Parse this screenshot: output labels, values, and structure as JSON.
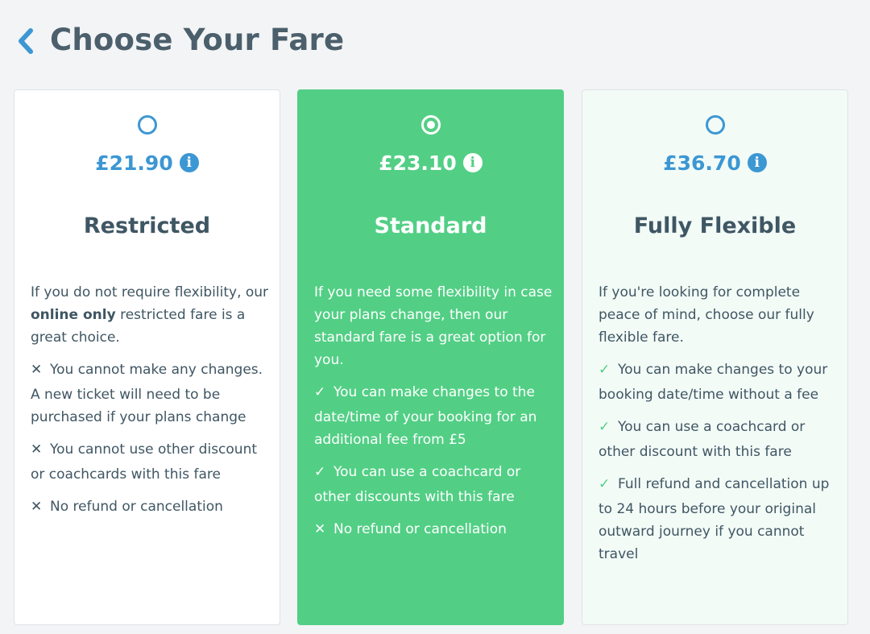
{
  "header": {
    "title": "Choose Your Fare",
    "back_icon": "chevron-left-icon",
    "accent_color": "#3c97d3"
  },
  "fares": [
    {
      "selected": false,
      "price": "£21.90",
      "name": "Restricted",
      "desc_pre": "If you do not require flexibility, our ",
      "desc_bold": "online only",
      "desc_post": " restricted fare is a great choice.",
      "features": [
        {
          "mark": "✕",
          "type": "cross",
          "first": "You cannot make any changes.",
          "rest": "A new ticket will need to be purchased if your plans change"
        },
        {
          "mark": "✕",
          "type": "cross",
          "first": "You cannot use other discount",
          "rest": "or coachcards with this fare"
        },
        {
          "mark": "✕",
          "type": "cross",
          "first": "No refund or cancellation",
          "rest": ""
        }
      ]
    },
    {
      "selected": true,
      "price": "£23.10",
      "name": "Standard",
      "desc_pre": "If you need some flexibility in case your plans change, then our standard fare is a great option for you.",
      "desc_bold": "",
      "desc_post": "",
      "features": [
        {
          "mark": "✓",
          "type": "tick",
          "first": "You can make changes to the",
          "rest": "date/time of your booking for an additional fee from £5"
        },
        {
          "mark": "✓",
          "type": "tick",
          "first": "You can use a coachcard or",
          "rest": "other discounts with this fare"
        },
        {
          "mark": "✕",
          "type": "cross",
          "first": "No refund or cancellation",
          "rest": ""
        }
      ]
    },
    {
      "selected": false,
      "price": "£36.70",
      "name": "Fully Flexible",
      "desc_pre": "If you're looking for complete peace of mind, choose our fully flexible fare.",
      "desc_bold": "",
      "desc_post": "",
      "features": [
        {
          "mark": "✓",
          "type": "tick",
          "first": "You can make changes to your",
          "rest": "booking date/time without a fee"
        },
        {
          "mark": "✓",
          "type": "tick",
          "first": "You can use a coachcard or",
          "rest": "other discount with this fare"
        },
        {
          "mark": "✓",
          "type": "tick",
          "first": "Full refund and cancellation up",
          "rest": "to 24 hours before your original outward journey if you cannot travel"
        }
      ]
    }
  ],
  "colors": {
    "selected_card": "#52cf85",
    "price_blue": "#3c97d3",
    "text": "#3f5663"
  }
}
